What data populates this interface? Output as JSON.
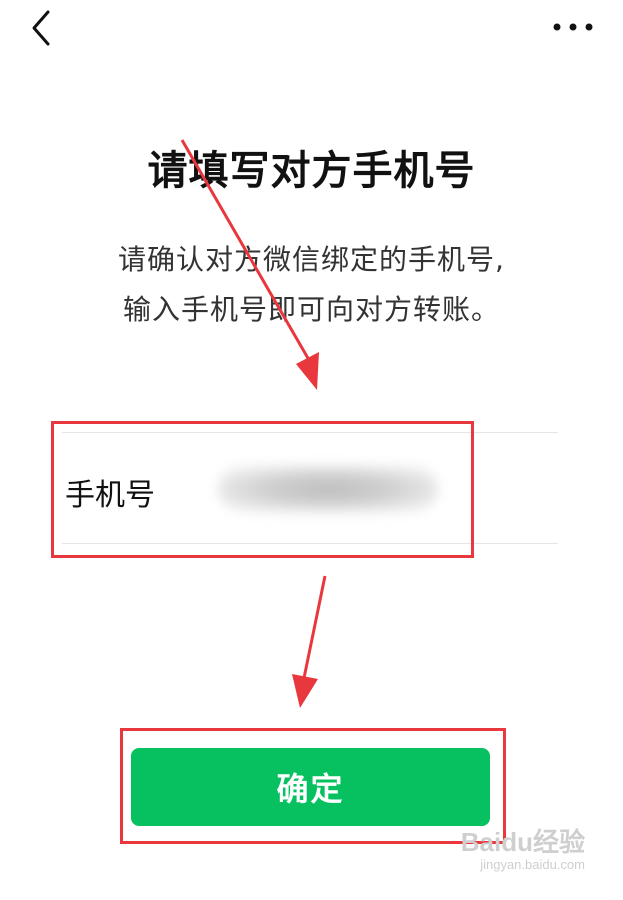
{
  "nav": {
    "back_icon": "chevron-left-icon",
    "more_icon": "more-dots-icon"
  },
  "header": {
    "title": "请填写对方手机号",
    "subtitle_line1": "请确认对方微信绑定的手机号,",
    "subtitle_line2": "输入手机号即可向对方转账。"
  },
  "form": {
    "phone_label": "手机号",
    "phone_value": ""
  },
  "actions": {
    "confirm_label": "确定"
  },
  "annotations": {
    "highlight_color": "#e8383d"
  },
  "colors": {
    "accent": "#07c160"
  },
  "watermark": {
    "logo": "Baidu经验",
    "url": "jingyan.baidu.com"
  }
}
